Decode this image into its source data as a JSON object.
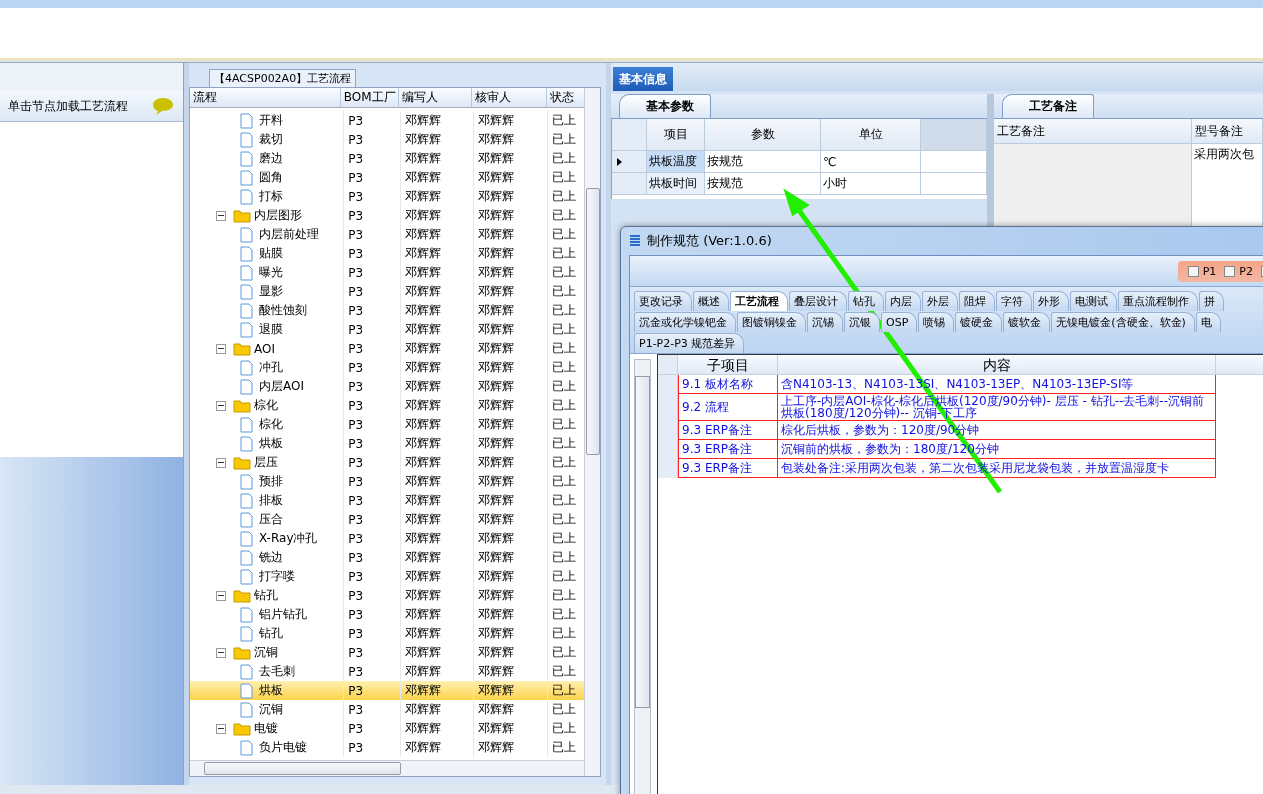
{
  "left_panel": {
    "hint": "单击节点加载工艺流程"
  },
  "flow_panel": {
    "title": "【4ACSP002A0】工艺流程",
    "columns": [
      "流程",
      "BOM工厂",
      "编写人",
      "核审人",
      "状态"
    ],
    "tree": [
      {
        "children": [
          {
            "label": "开料",
            "bom": "P3",
            "writer": "邓辉辉",
            "reviewer": "邓辉辉",
            "status": "已上",
            "selected": false
          },
          {
            "label": "裁切",
            "bom": "P3",
            "writer": "邓辉辉",
            "reviewer": "邓辉辉",
            "status": "已上",
            "selected": false
          },
          {
            "label": "磨边",
            "bom": "P3",
            "writer": "邓辉辉",
            "reviewer": "邓辉辉",
            "status": "已上",
            "selected": false
          },
          {
            "label": "圆角",
            "bom": "P3",
            "writer": "邓辉辉",
            "reviewer": "邓辉辉",
            "status": "已上",
            "selected": false
          },
          {
            "label": "打标",
            "bom": "P3",
            "writer": "邓辉辉",
            "reviewer": "邓辉辉",
            "status": "已上",
            "selected": false
          }
        ]
      },
      {
        "label": "内层图形",
        "bom": "P3",
        "writer": "邓辉辉",
        "reviewer": "邓辉辉",
        "status": "已上",
        "selected": false,
        "children": [
          {
            "label": "内层前处理",
            "bom": "P3",
            "writer": "邓辉辉",
            "reviewer": "邓辉辉",
            "status": "已上",
            "selected": false
          },
          {
            "label": "贴膜",
            "bom": "P3",
            "writer": "邓辉辉",
            "reviewer": "邓辉辉",
            "status": "已上",
            "selected": false
          },
          {
            "label": "曝光",
            "bom": "P3",
            "writer": "邓辉辉",
            "reviewer": "邓辉辉",
            "status": "已上",
            "selected": false
          },
          {
            "label": "显影",
            "bom": "P3",
            "writer": "邓辉辉",
            "reviewer": "邓辉辉",
            "status": "已上",
            "selected": false
          },
          {
            "label": "酸性蚀刻",
            "bom": "P3",
            "writer": "邓辉辉",
            "reviewer": "邓辉辉",
            "status": "已上",
            "selected": false
          },
          {
            "label": "退膜",
            "bom": "P3",
            "writer": "邓辉辉",
            "reviewer": "邓辉辉",
            "status": "已上",
            "selected": false
          }
        ]
      },
      {
        "label": "AOI",
        "bom": "P3",
        "writer": "邓辉辉",
        "reviewer": "邓辉辉",
        "status": "已上",
        "selected": false,
        "children": [
          {
            "label": "冲孔",
            "bom": "P3",
            "writer": "邓辉辉",
            "reviewer": "邓辉辉",
            "status": "已上",
            "selected": false
          },
          {
            "label": "内层AOI",
            "bom": "P3",
            "writer": "邓辉辉",
            "reviewer": "邓辉辉",
            "status": "已上",
            "selected": false
          }
        ]
      },
      {
        "label": "棕化",
        "bom": "P3",
        "writer": "邓辉辉",
        "reviewer": "邓辉辉",
        "status": "已上",
        "selected": false,
        "children": [
          {
            "label": "棕化",
            "bom": "P3",
            "writer": "邓辉辉",
            "reviewer": "邓辉辉",
            "status": "已上",
            "selected": false
          },
          {
            "label": "烘板",
            "bom": "P3",
            "writer": "邓辉辉",
            "reviewer": "邓辉辉",
            "status": "已上",
            "selected": false
          }
        ]
      },
      {
        "label": "层压",
        "bom": "P3",
        "writer": "邓辉辉",
        "reviewer": "邓辉辉",
        "status": "已上",
        "selected": false,
        "children": [
          {
            "label": "预排",
            "bom": "P3",
            "writer": "邓辉辉",
            "reviewer": "邓辉辉",
            "status": "已上",
            "selected": false
          },
          {
            "label": "排板",
            "bom": "P3",
            "writer": "邓辉辉",
            "reviewer": "邓辉辉",
            "status": "已上",
            "selected": false
          },
          {
            "label": "压合",
            "bom": "P3",
            "writer": "邓辉辉",
            "reviewer": "邓辉辉",
            "status": "已上",
            "selected": false
          },
          {
            "label": "X-Ray冲孔",
            "bom": "P3",
            "writer": "邓辉辉",
            "reviewer": "邓辉辉",
            "status": "已上",
            "selected": false
          },
          {
            "label": "铣边",
            "bom": "P3",
            "writer": "邓辉辉",
            "reviewer": "邓辉辉",
            "status": "已上",
            "selected": false
          },
          {
            "label": "打字喽",
            "bom": "P3",
            "writer": "邓辉辉",
            "reviewer": "邓辉辉",
            "status": "已上",
            "selected": false
          }
        ]
      },
      {
        "label": "钻孔",
        "bom": "P3",
        "writer": "邓辉辉",
        "reviewer": "邓辉辉",
        "status": "已上",
        "selected": false,
        "children": [
          {
            "label": "铝片钻孔",
            "bom": "P3",
            "writer": "邓辉辉",
            "reviewer": "邓辉辉",
            "status": "已上",
            "selected": false
          },
          {
            "label": "钻孔",
            "bom": "P3",
            "writer": "邓辉辉",
            "reviewer": "邓辉辉",
            "status": "已上",
            "selected": false
          }
        ]
      },
      {
        "label": "沉铜",
        "bom": "P3",
        "writer": "邓辉辉",
        "reviewer": "邓辉辉",
        "status": "已上",
        "selected": false,
        "children": [
          {
            "label": "去毛刺",
            "bom": "P3",
            "writer": "邓辉辉",
            "reviewer": "邓辉辉",
            "status": "已上",
            "selected": false
          },
          {
            "label": "烘板",
            "bom": "P3",
            "writer": "邓辉辉",
            "reviewer": "邓辉辉",
            "status": "已上",
            "selected": true
          },
          {
            "label": "沉铜",
            "bom": "P3",
            "writer": "邓辉辉",
            "reviewer": "邓辉辉",
            "status": "已上",
            "selected": false
          }
        ]
      },
      {
        "label": "电镀",
        "bom": "P3",
        "writer": "邓辉辉",
        "reviewer": "邓辉辉",
        "status": "已上",
        "selected": false,
        "children": [
          {
            "label": "负片电镀",
            "bom": "P3",
            "writer": "邓辉辉",
            "reviewer": "邓辉辉",
            "status": "已上",
            "selected": false
          }
        ]
      }
    ]
  },
  "info_panel": {
    "tab": "基本信息",
    "params": {
      "tab": "基本参数",
      "columns": [
        "项目",
        "参数",
        "单位"
      ],
      "rows": [
        {
          "item": "烘板温度",
          "param": "按规范",
          "unit": "℃",
          "selected": true
        },
        {
          "item": "烘板时间",
          "param": "按规范",
          "unit": "小时",
          "selected": false
        }
      ]
    },
    "notes": {
      "tab": "工艺备注",
      "columns": [
        "工艺备注",
        "型号备注"
      ],
      "model_note": "采用两次包"
    }
  },
  "dialog": {
    "title": "制作规范 (Ver:1.0.6)",
    "checkboxes": [
      {
        "label": "P1",
        "checked": false
      },
      {
        "label": "P2",
        "checked": false
      },
      {
        "checked": false
      }
    ],
    "tab_rows": [
      [
        {
          "label": "更改记录",
          "selected": false
        },
        {
          "label": "概述",
          "selected": false
        },
        {
          "label": "工艺流程",
          "selected": true
        },
        {
          "label": "叠层设计",
          "selected": false
        },
        {
          "label": "钻孔",
          "selected": false
        },
        {
          "label": "内层",
          "selected": false
        },
        {
          "label": "外层",
          "selected": false
        },
        {
          "label": "阻焊",
          "selected": false
        },
        {
          "label": "字符",
          "selected": false
        },
        {
          "label": "外形",
          "selected": false
        },
        {
          "label": "电测试",
          "selected": false
        },
        {
          "label": "重点流程制作",
          "selected": false
        },
        {
          "label": "拼",
          "selected": false
        }
      ],
      [
        {
          "label": "沉金或化学镍钯金",
          "selected": false
        },
        {
          "label": "图镀铜镍金",
          "selected": false
        },
        {
          "label": "沉锡",
          "selected": false
        },
        {
          "label": "沉银",
          "selected": false
        },
        {
          "label": "OSP",
          "selected": false
        },
        {
          "label": "喷锡",
          "selected": false
        },
        {
          "label": "镀硬金",
          "selected": false
        },
        {
          "label": "镀软金",
          "selected": false
        },
        {
          "label": "无镍电镀金(含硬金、软金)",
          "selected": false
        },
        {
          "label": "电",
          "selected": false
        }
      ],
      [
        {
          "label": "P1-P2-P3 规范差异",
          "selected": false
        }
      ]
    ],
    "columns": [
      "子项目",
      "内容"
    ],
    "rows": [
      {
        "sub": "9.1 板材名称",
        "content": "含N4103-13、N4103-13SI、N4103-13EP、N4103-13EP-SI等"
      },
      {
        "sub": "9.2 流程",
        "content": "上工序-内层AOI-棕化-棕化后烘板(120度/90分钟)- 层压 - 钻孔--去毛刺--沉铜前烘板(180度/120分钟)-- 沉铜-下工序"
      },
      {
        "sub": "9.3 ERP备注",
        "content": "棕化后烘板，参数为：120度/90分钟"
      },
      {
        "sub": "9.3 ERP备注",
        "content": "沉铜前的烘板，参数为：180度/120分钟"
      },
      {
        "sub": "9.3 ERP备注",
        "content": "包装处备注:采用两次包装，第二次包装采用尼龙袋包装，并放置温湿度卡"
      }
    ]
  }
}
